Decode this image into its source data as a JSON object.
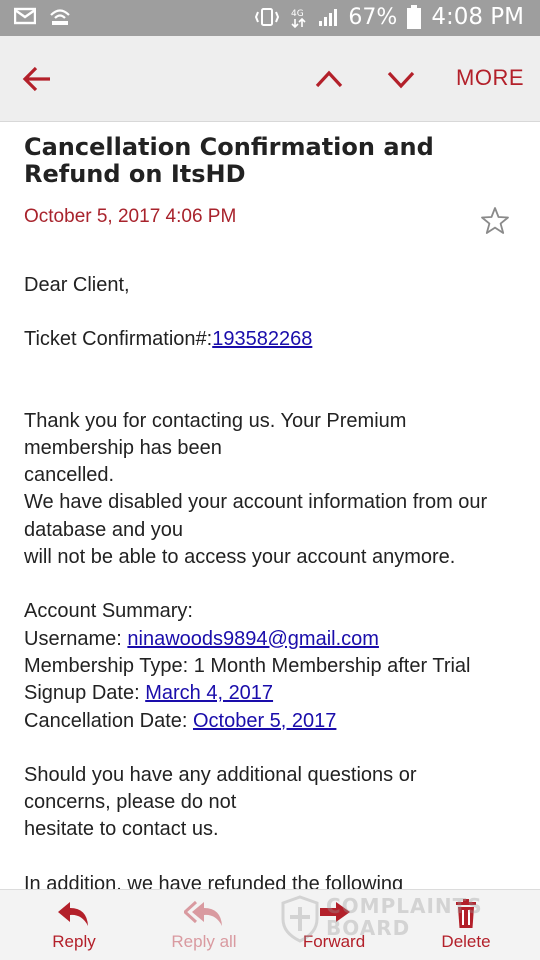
{
  "status_bar": {
    "battery_percent": "67%",
    "time": "4:08 PM"
  },
  "action_bar": {
    "more_label": "MORE"
  },
  "email": {
    "subject": "Cancellation Confirmation and Refund on ItsHD",
    "date": "October 5, 2017  4:06 PM",
    "greeting": "Dear Client,",
    "ticket_label": "Ticket Confirmation#:",
    "ticket_number": "193582268",
    "para1": "Thank you for contacting us.   Your Premium membership has been",
    "para1b": "cancelled.",
    "para2": "We have disabled your account information from our database and you",
    "para2b": "will not be able to access your account anymore.",
    "summary_heading": "Account Summary:",
    "username_label": "Username: ",
    "username_value": "ninawoods9894@gmail.com",
    "membership_type": "Membership Type: 1 Month Membership after Trial",
    "signup_label": "Signup Date:  ",
    "signup_value": "March 4, 2017",
    "cancel_label": "Cancellation Date: ",
    "cancel_value": "October 5, 2017",
    "para3": "Should you have any additional questions or concerns, please do not",
    "para3b": "hesitate to contact us.",
    "para4_partial": "In addition, we have refunded the following"
  },
  "bottom_bar": {
    "reply": "Reply",
    "reply_all": "Reply all",
    "forward": "Forward",
    "delete": "Delete"
  },
  "watermark": {
    "line1": "COMPLAINTS",
    "line2": "BOARD"
  },
  "colors": {
    "accent": "#b3202a",
    "link": "#1a0dab",
    "status_bar": "#9e9e9e"
  }
}
